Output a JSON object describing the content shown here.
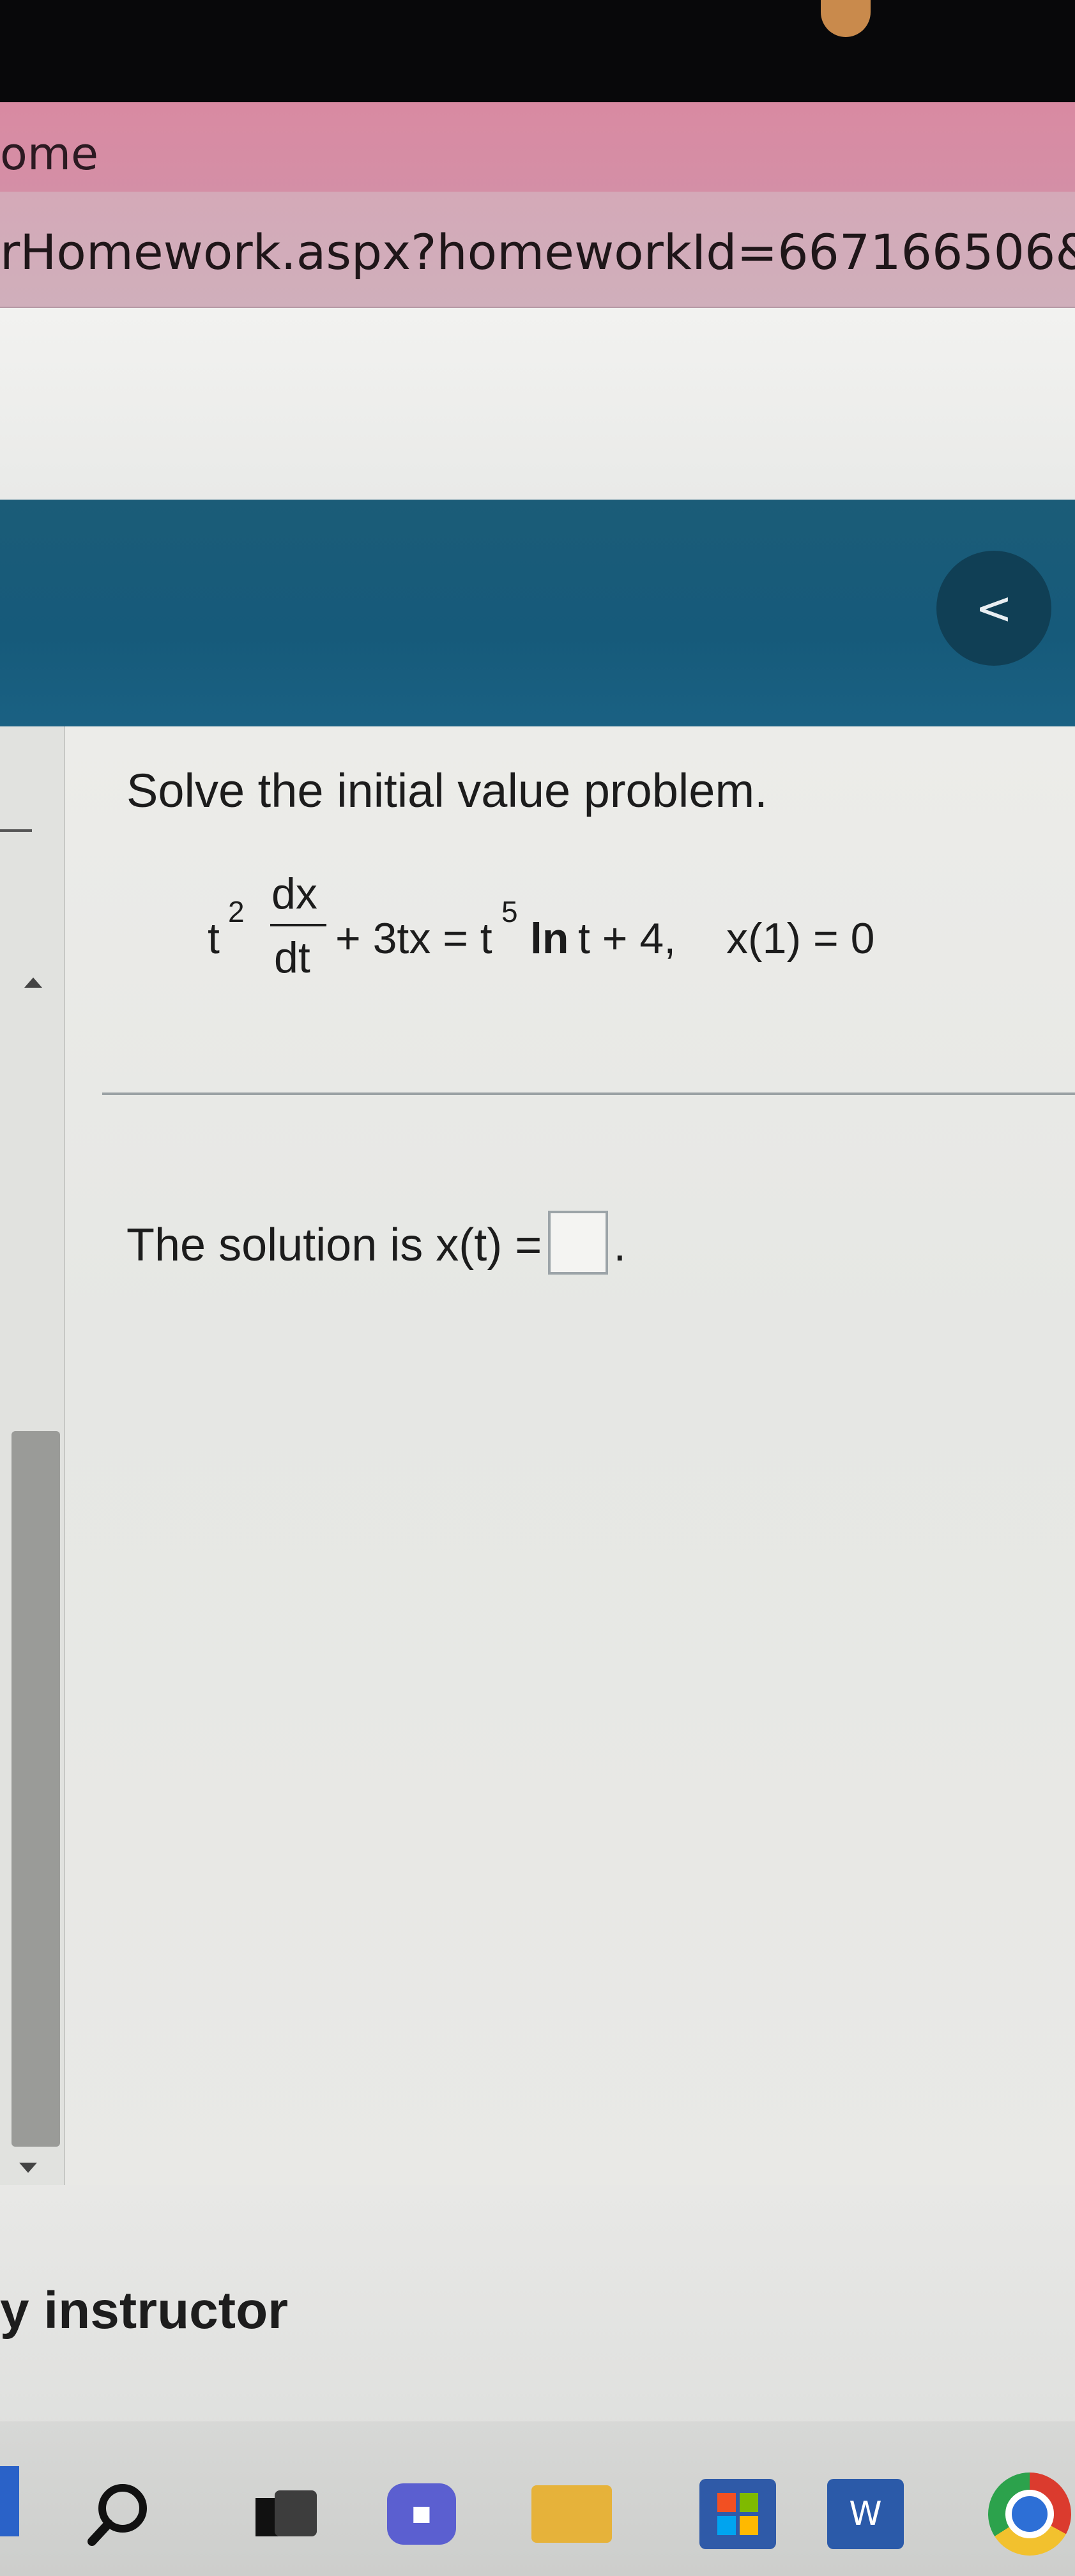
{
  "browser": {
    "tab_title": "ome",
    "url": "rHomework.aspx?homeworkId=667166506&que"
  },
  "header": {
    "back_label": "<"
  },
  "question": {
    "prompt": "Solve the initial value problem.",
    "equation": {
      "coef": "t",
      "exp2": "2",
      "frac_num": "dx",
      "frac_den": "dt",
      "middle": "+ 3tx = t",
      "exp5": "5",
      "ln": "ln",
      "rest": "t + 4,",
      "initial_condition": "x(1) = 0"
    },
    "solution_prefix": "The solution is x(t) =",
    "solution_suffix": "."
  },
  "footer": {
    "instructor_label": "y instructor"
  },
  "taskbar": {
    "word_label": "W"
  },
  "colors": {
    "header_teal": "#165a7a",
    "tab_pink": "#d98aa2",
    "back_button": "#103f55"
  },
  "icons": [
    "search-icon",
    "task-view-icon",
    "meet-icon",
    "file-explorer-icon",
    "store-icon",
    "word-icon",
    "chrome-icon"
  ]
}
